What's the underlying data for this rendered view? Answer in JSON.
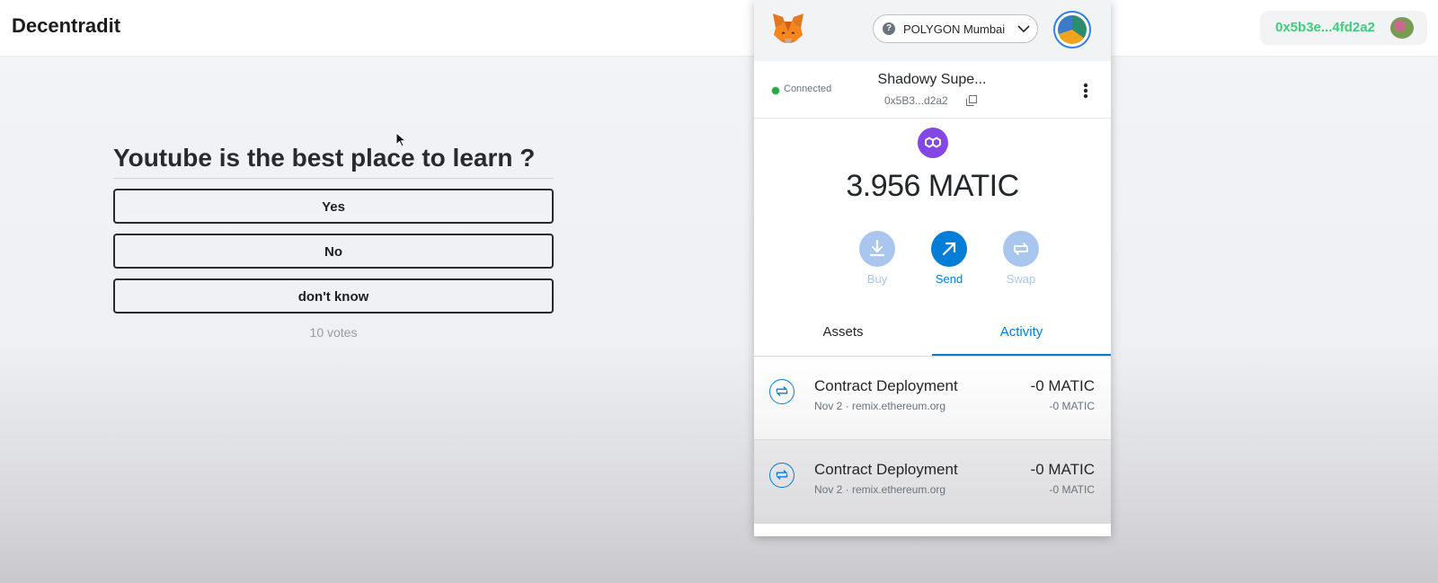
{
  "app": {
    "title": "Decentradit",
    "wallet_address": "0x5b3e...4fd2a2"
  },
  "poll": {
    "question": "Youtube is the best place to learn ?",
    "options": [
      "Yes",
      "No",
      "don't know"
    ],
    "votes": "10 votes"
  },
  "metamask": {
    "network": "POLYGON Mumbai",
    "connection_status": "Connected",
    "account_name": "Shadowy Supe...",
    "account_address": "0x5B3...d2a2",
    "balance": "3.956 MATIC",
    "actions": [
      {
        "label": "Buy",
        "icon": "download-icon",
        "color": "#a9c6ef"
      },
      {
        "label": "Send",
        "icon": "arrow-up-right-icon",
        "color": "#037dd6"
      },
      {
        "label": "Swap",
        "icon": "swap-icon",
        "color": "#a9c6ef"
      }
    ],
    "tabs": [
      "Assets",
      "Activity"
    ],
    "active_tab": "Activity",
    "transactions": [
      {
        "title": "Contract Deployment",
        "subtitle": "Nov 2 · remix.ethereum.org",
        "amount": "-0 MATIC",
        "amount_secondary": "-0 MATIC"
      },
      {
        "title": "Contract Deployment",
        "subtitle": "Nov 2 · remix.ethereum.org",
        "amount": "-0 MATIC",
        "amount_secondary": "-0 MATIC"
      }
    ]
  },
  "colors": {
    "accent": "#037dd6",
    "wallet_text": "#3ccf7b",
    "polygon": "#8247e5"
  }
}
